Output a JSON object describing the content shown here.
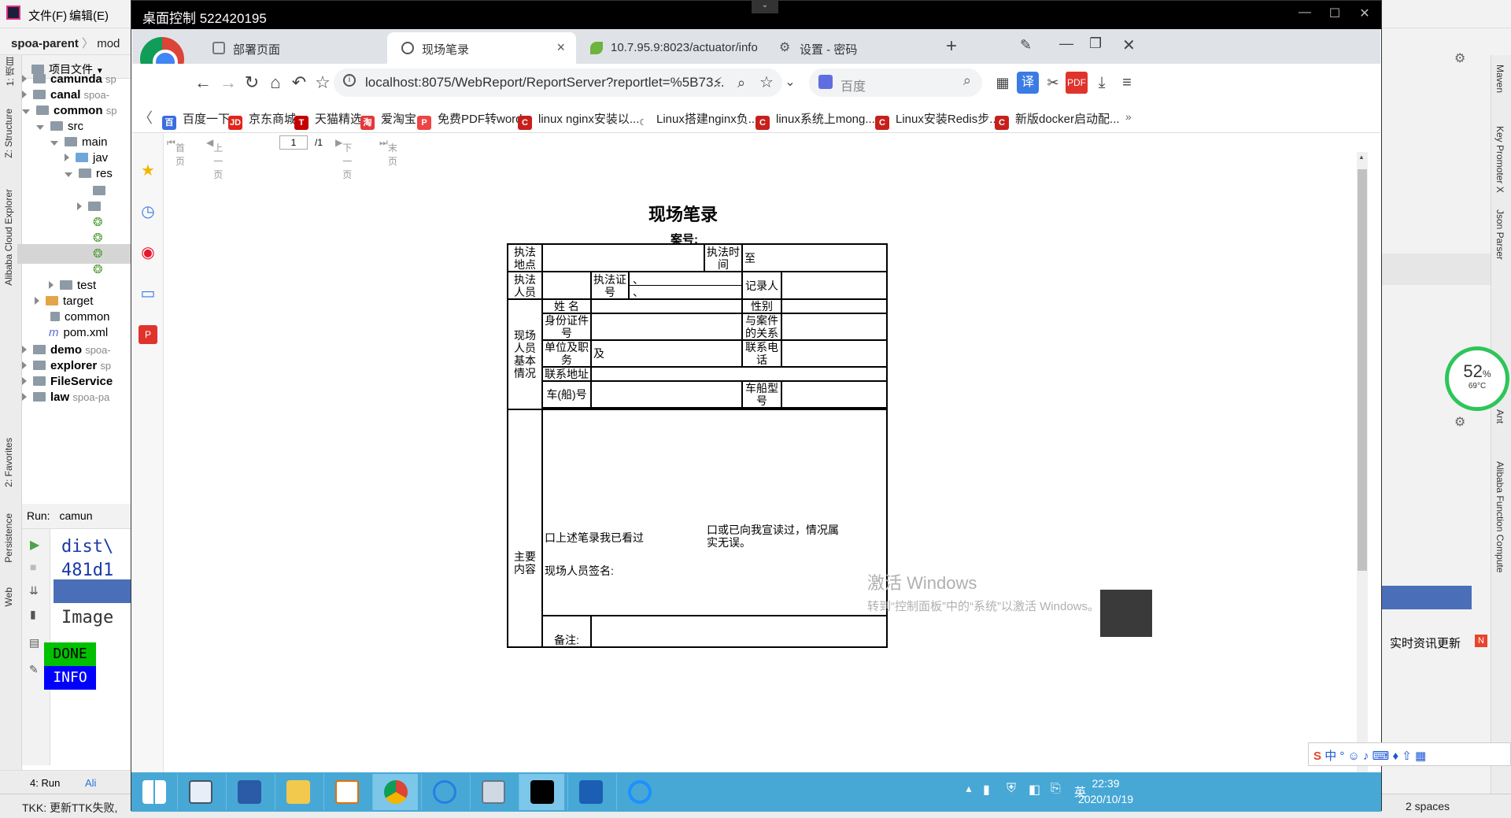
{
  "ide": {
    "menu": [
      "文件(F)",
      "编辑(E)"
    ],
    "breadcrumb": "spoa-parent",
    "breadcrumb_more": "mod",
    "project_header": "项目文件",
    "tree": [
      {
        "label": "camunda",
        "suffix": "sp"
      },
      {
        "label": "canal",
        "suffix": "spoa-"
      },
      {
        "label": "common",
        "suffix": "sp"
      },
      {
        "label": "src",
        "suffix": ""
      },
      {
        "label": "main",
        "suffix": ""
      },
      {
        "label": "jav",
        "suffix": ""
      },
      {
        "label": "res",
        "suffix": ""
      },
      {
        "label": "test",
        "suffix": ""
      },
      {
        "label": "target",
        "suffix": ""
      },
      {
        "label": "common",
        "suffix": ""
      },
      {
        "label": "pom.xml",
        "suffix": ""
      },
      {
        "label": "demo",
        "suffix": "spoa-"
      },
      {
        "label": "explorer",
        "suffix": "sp"
      },
      {
        "label": "FileService",
        "suffix": ""
      },
      {
        "label": "law",
        "suffix": "spoa-pa"
      }
    ],
    "run_label": "Run:",
    "run_config": "camun",
    "run_output": [
      "dist\\",
      "481d1",
      "Image"
    ],
    "done_badge": "DONE",
    "info_badge": "INFO",
    "bottom_tabs": [
      "4: Run",
      "Ali"
    ],
    "status_text": "TKK: 更新TTK失败,",
    "status_right": "2 spaces",
    "left_tool_labels": [
      "1: 项目",
      "Z: Structure",
      "Alibaba Cloud Explorer",
      "2: Favorites",
      "Persistence",
      "Web"
    ],
    "right_tool_labels": [
      "Maven",
      "Key Promoter X",
      "Json Parser",
      "Ant",
      "Alibaba Function Compute"
    ],
    "right_notice": "实时资讯更新",
    "gauge_percent": "52",
    "gauge_temp": "69°C"
  },
  "remote": {
    "title": "桌面控制 522420195"
  },
  "browser": {
    "tabs": [
      {
        "label": "部署页面",
        "active": false
      },
      {
        "label": "现场笔录",
        "active": true
      },
      {
        "label": "10.7.95.9:8023/actuator/info",
        "active": false
      },
      {
        "label": "设置 - 密码",
        "active": false
      }
    ],
    "url": "localhost:8075/WebReport/ReportServer?reportlet=%5B73...",
    "search_placeholder": "百度",
    "bookmarks": [
      "百度一下",
      "京东商城",
      "天猫精选",
      "爱淘宝",
      "免费PDF转word",
      "linux nginx安装以...",
      "Linux搭建nginx负...",
      "linux系统上mong...",
      "Linux安装Redis步...",
      "新版docker启动配..."
    ],
    "pager": {
      "first": "首页",
      "prev": "上一页",
      "page": "1",
      "total": "/1",
      "next": "下一页",
      "last": "末页"
    }
  },
  "report": {
    "title": "现场笔录",
    "case_no": "案号:",
    "r1": {
      "a": "执法地点",
      "b": "执法时间",
      "c": "至"
    },
    "r2": {
      "a": "执法人员",
      "b": "执法证号",
      "c1": "、",
      "c2": "、",
      "d": "记录人"
    },
    "section": "现场人员基本情况",
    "name": "姓 名",
    "gender": "性别",
    "id_no": "身份证件号",
    "relation": "与案件的关系",
    "unit": "单位及职务",
    "unit_val": "及",
    "phone": "联系电话",
    "address": "联系地址",
    "vehicle": "车(船)号",
    "vehicle_type": "车船型号",
    "main": "主要内容",
    "read": "口上述笔录我已看过",
    "readout": "口或已向我宣读过，情况属实无误。",
    "sign": "现场人员签名:",
    "note": "备注:"
  },
  "watermark": {
    "line1": "激活 Windows",
    "line2": "转到“控制面板”中的“系统”以激活 Windows。"
  },
  "taskbar": {
    "time": "22:39",
    "date": "2020/10/19",
    "ime": "英"
  },
  "colors": {
    "taskbar": "#47a8d6",
    "done": "#00c000",
    "info": "#0000ff",
    "gauge": "#2ec55a"
  }
}
